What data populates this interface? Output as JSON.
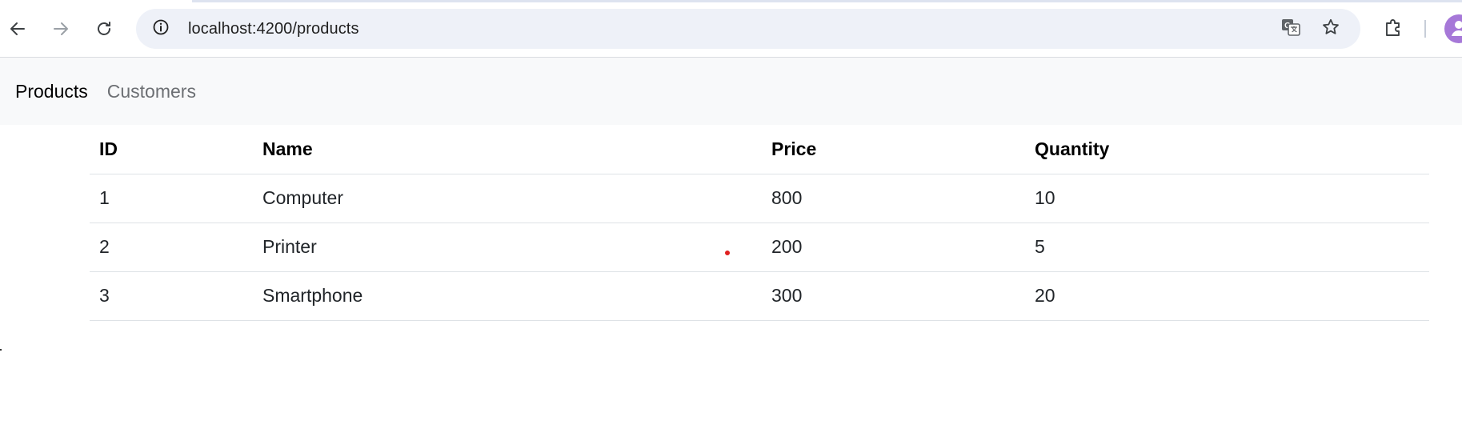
{
  "browser": {
    "url": "localhost:4200/products",
    "icons": {
      "back": "arrow-left-icon",
      "forward": "arrow-right-icon",
      "reload": "reload-icon",
      "site_info": "info-circle-icon",
      "translate": "translate-icon",
      "bookmark": "star-icon",
      "extensions": "puzzle-icon",
      "profile": "avatar-icon"
    },
    "colors": {
      "omnibox_bg": "#eef1f8",
      "avatar_bg": "#a678d8"
    }
  },
  "navbar": {
    "links": [
      {
        "label": "Products",
        "active": true
      },
      {
        "label": "Customers",
        "active": false
      }
    ]
  },
  "table": {
    "headers": [
      "ID",
      "Name",
      "Price",
      "Quantity"
    ],
    "rows": [
      [
        "1",
        "Computer",
        "800",
        "10"
      ],
      [
        "2",
        "Printer",
        "200",
        "5"
      ],
      [
        "3",
        "Smartphone",
        "300",
        "20"
      ]
    ]
  }
}
